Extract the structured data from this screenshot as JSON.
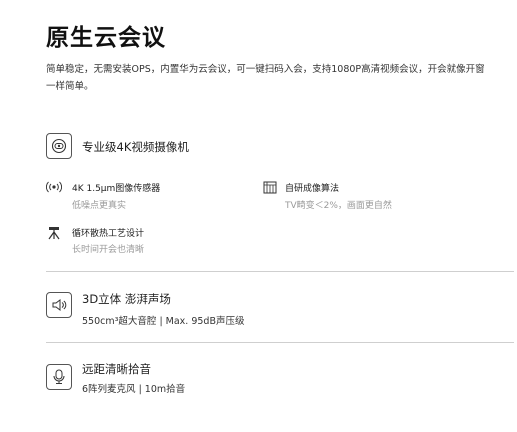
{
  "title": "原生云会议",
  "intro": "简单稳定，无需安装OPS，内置华为云会议，可一键扫码入会，支持1080P高清视频会议，开会就像开窗一样简单。",
  "camera": {
    "icon": "camera-lens-icon",
    "title": "专业级4K视频摄像机",
    "specs": [
      {
        "icon": "sensor-signal-icon",
        "name": "4K 1.5μm图像传感器",
        "desc": "低噪点更真实"
      },
      {
        "icon": "image-algorithm-icon",
        "name": "自研成像算法",
        "desc": "TV畸变＜2%，画面更自然"
      },
      {
        "icon": "tripod-icon",
        "name": "循环散热工艺设计",
        "desc": "长时间开会也清晰"
      }
    ]
  },
  "audio": {
    "icon": "speaker-icon",
    "title": "3D立体 澎湃声场",
    "subtitle": "550cm³超大音腔 | Max. 95dB声压级"
  },
  "mic": {
    "icon": "microphone-icon",
    "title": "远距清晰拾音",
    "subtitle": "6阵列麦克风 | 10m拾音"
  }
}
